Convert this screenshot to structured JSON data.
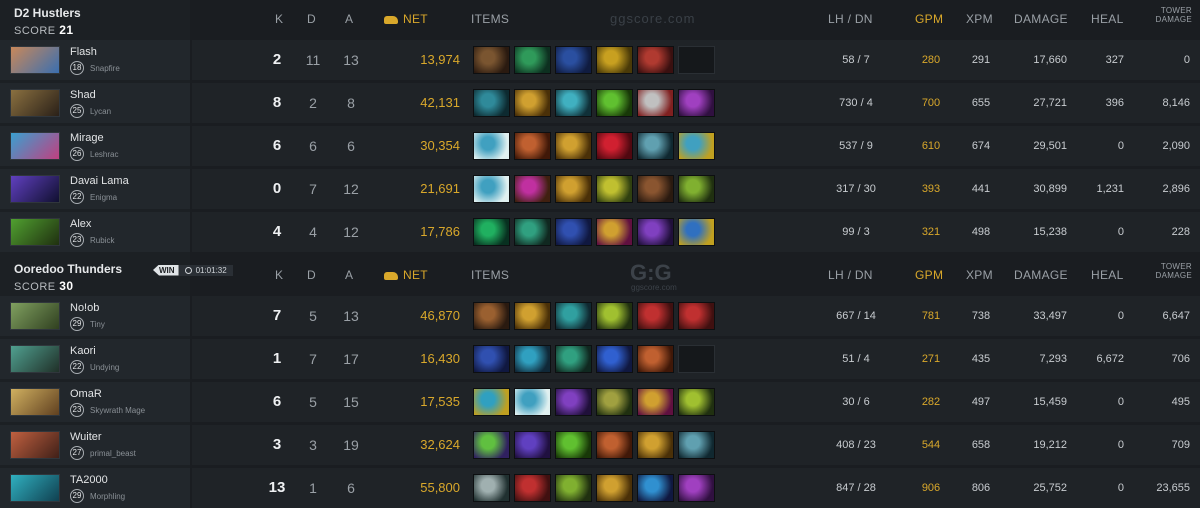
{
  "watermark": {
    "top": "ggscore.com",
    "mid_logo": "G:G",
    "mid_sub": "ggscore.com"
  },
  "colors": {
    "gold": "#d9a82b",
    "bg": "#1a1d21"
  },
  "headers": {
    "k": "K",
    "d": "D",
    "a": "A",
    "net": "NET",
    "net_icon": "gold-coins-icon",
    "items": "ITEMS",
    "lh_dn": "LH  /  DN",
    "gpm": "GPM",
    "xpm": "XPM",
    "damage": "DAMAGE",
    "heal": "HEAL",
    "tower_1": "TOWER",
    "tower_2": "DAMAGE"
  },
  "teams": [
    {
      "name": "D2 Hustlers",
      "score_label": "SCORE",
      "score": "21",
      "players": [
        {
          "name": "Flash",
          "level": "18",
          "hero": "Snapfire",
          "k": "2",
          "d": "11",
          "a": "13",
          "net": "13,974",
          "lh_dn": "58  /  7",
          "gpm": "280",
          "xpm": "291",
          "damage": "17,660",
          "heal": "327",
          "tower": "0",
          "portrait": [
            "#c9885a",
            "#3a6fb0"
          ],
          "items": [
            [
              "#7a5530",
              "#2a1a10"
            ],
            [
              "#2f9a5a",
              "#0d3020"
            ],
            [
              "#2a4fa0",
              "#101c40"
            ],
            [
              "#c8a020",
              "#4a3a08"
            ],
            [
              "#b03a30",
              "#3a1010"
            ],
            null
          ]
        },
        {
          "name": "Shad",
          "level": "25",
          "hero": "Lycan",
          "k": "8",
          "d": "2",
          "a": "8",
          "net": "42,131",
          "lh_dn": "730  /  4",
          "gpm": "700",
          "xpm": "655",
          "damage": "27,721",
          "heal": "396",
          "tower": "8,146",
          "portrait": [
            "#8a7040",
            "#2a2018"
          ],
          "items": [
            [
              "#2f8a9a",
              "#0d2a30"
            ],
            [
              "#d0a030",
              "#4a3008"
            ],
            [
              "#40b0c0",
              "#103038"
            ],
            [
              "#60c030",
              "#183808"
            ],
            [
              "#c0c0c0",
              "#802020"
            ],
            [
              "#a040c0",
              "#301040"
            ]
          ]
        },
        {
          "name": "Mirage",
          "level": "26",
          "hero": "Leshrac",
          "k": "6",
          "d": "6",
          "a": "6",
          "net": "30,354",
          "lh_dn": "537  /  9",
          "gpm": "610",
          "xpm": "674",
          "damage": "29,501",
          "heal": "0",
          "tower": "2,090",
          "portrait": [
            "#3aa0d0",
            "#c04080"
          ],
          "items": [
            [
              "#40a0c0",
              "#e0f0f0"
            ],
            [
              "#c06030",
              "#401808"
            ],
            [
              "#d0a030",
              "#4a3008"
            ],
            [
              "#d02030",
              "#500810"
            ],
            [
              "#60a0b0",
              "#102830"
            ],
            [
              "#40a0c0",
              "#c0a020"
            ]
          ]
        },
        {
          "name": "Davai Lama",
          "level": "22",
          "hero": "Enigma",
          "k": "0",
          "d": "7",
          "a": "12",
          "net": "21,691",
          "lh_dn": "317  /  30",
          "gpm": "393",
          "xpm": "441",
          "damage": "30,899",
          "heal": "1,231",
          "tower": "2,896",
          "portrait": [
            "#6040c0",
            "#101030"
          ],
          "items": [
            [
              "#40a0c0",
              "#e0f0f0"
            ],
            [
              "#c030a0",
              "#402010"
            ],
            [
              "#d0a030",
              "#4a3008"
            ],
            [
              "#c0c030",
              "#304010"
            ],
            [
              "#8a5530",
              "#2a1a10"
            ],
            [
              "#80b030",
              "#203010"
            ]
          ]
        },
        {
          "name": "Alex",
          "level": "23",
          "hero": "Rubick",
          "k": "4",
          "d": "4",
          "a": "12",
          "net": "17,786",
          "lh_dn": "99  /  3",
          "gpm": "321",
          "xpm": "498",
          "damage": "15,238",
          "heal": "0",
          "tower": "228",
          "portrait": [
            "#50a030",
            "#203010"
          ],
          "items": [
            [
              "#20b060",
              "#083020"
            ],
            [
              "#30a080",
              "#102820"
            ],
            [
              "#3050b0",
              "#101840"
            ],
            [
              "#d0a030",
              "#601040"
            ],
            [
              "#8040c0",
              "#20103a"
            ],
            [
              "#3070c0",
              "#c0a020"
            ]
          ]
        }
      ]
    },
    {
      "name": "Ooredoo Thunders",
      "score_label": "SCORE",
      "score": "30",
      "win_label": "WIN",
      "clock_icon": "clock-icon",
      "duration": "01:01:32",
      "players": [
        {
          "name": "No!ob",
          "level": "29",
          "hero": "Tiny",
          "k": "7",
          "d": "5",
          "a": "13",
          "net": "46,870",
          "lh_dn": "667  /  14",
          "gpm": "781",
          "xpm": "738",
          "damage": "33,497",
          "heal": "0",
          "tower": "6,647",
          "portrait": [
            "#80a060",
            "#304020"
          ],
          "items": [
            [
              "#9a6030",
              "#2a1a10"
            ],
            [
              "#d0a030",
              "#4a3008"
            ],
            [
              "#30a0a0",
              "#102830"
            ],
            [
              "#a0c030",
              "#203010"
            ],
            [
              "#c03030",
              "#401010"
            ],
            [
              "#c03030",
              "#401010"
            ]
          ]
        },
        {
          "name": "Kaori",
          "level": "22",
          "hero": "Undying",
          "k": "1",
          "d": "7",
          "a": "17",
          "net": "16,430",
          "lh_dn": "51  /  4",
          "gpm": "271",
          "xpm": "435",
          "damage": "7,293",
          "heal": "6,672",
          "tower": "706",
          "portrait": [
            "#50a090",
            "#203028"
          ],
          "items": [
            [
              "#3050b0",
              "#101840"
            ],
            [
              "#30a0c0",
              "#102838"
            ],
            [
              "#30a080",
              "#102820"
            ],
            [
              "#3060d0",
              "#101840"
            ],
            [
              "#c06030",
              "#401808"
            ],
            null
          ]
        },
        {
          "name": "OmaR",
          "level": "23",
          "hero": "Skywrath Mage",
          "k": "6",
          "d": "5",
          "a": "15",
          "net": "17,535",
          "lh_dn": "30  /  6",
          "gpm": "282",
          "xpm": "497",
          "damage": "15,459",
          "heal": "0",
          "tower": "495",
          "portrait": [
            "#d0b060",
            "#604020"
          ],
          "items": [
            [
              "#30a0c0",
              "#c0a020"
            ],
            [
              "#40a0c0",
              "#e0f0f0"
            ],
            [
              "#8040c0",
              "#20103a"
            ],
            [
              "#a0a040",
              "#203010"
            ],
            [
              "#d0a030",
              "#601040"
            ],
            [
              "#a0c030",
              "#203010"
            ]
          ]
        },
        {
          "name": "Wuiter",
          "level": "27",
          "hero": "primal_beast",
          "k": "3",
          "d": "3",
          "a": "19",
          "net": "32,624",
          "lh_dn": "408  /  23",
          "gpm": "544",
          "xpm": "658",
          "damage": "19,212",
          "heal": "0",
          "tower": "709",
          "portrait": [
            "#c06040",
            "#402018"
          ],
          "items": [
            [
              "#60c040",
              "#302060"
            ],
            [
              "#6040c0",
              "#201040"
            ],
            [
              "#60c030",
              "#183808"
            ],
            [
              "#c06030",
              "#401808"
            ],
            [
              "#d0a030",
              "#4a3008"
            ],
            [
              "#60a0b0",
              "#102830"
            ]
          ]
        },
        {
          "name": "TA2000",
          "level": "29",
          "hero": "Morphling",
          "k": "13",
          "d": "1",
          "a": "6",
          "net": "55,800",
          "lh_dn": "847  /  28",
          "gpm": "906",
          "xpm": "806",
          "damage": "25,752",
          "heal": "0",
          "tower": "23,655",
          "portrait": [
            "#30b0c0",
            "#104050"
          ],
          "items": [
            [
              "#a0b0b0",
              "#203030"
            ],
            [
              "#c03030",
              "#401010"
            ],
            [
              "#80b030",
              "#203010"
            ],
            [
              "#d0a030",
              "#4a3008"
            ],
            [
              "#3090d0",
              "#101840"
            ],
            [
              "#a040c0",
              "#301040"
            ]
          ]
        }
      ]
    }
  ]
}
